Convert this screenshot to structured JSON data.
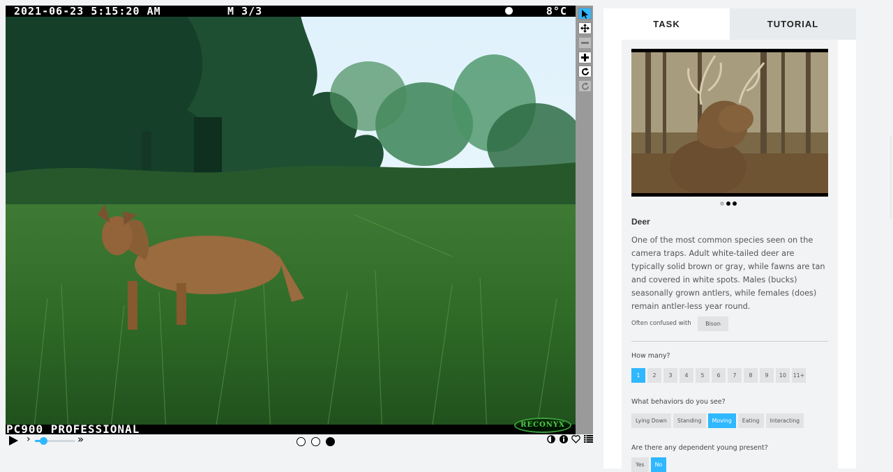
{
  "viewer": {
    "timestamp": "2021-06-23 5:15:20 AM",
    "mode": "M 3/3",
    "temperature": "8°C",
    "camera_model": "PC900 PROFESSIONAL",
    "brand_logo": "RECONYX",
    "tools": [
      {
        "name": "annotate-pointer-icon",
        "glyph": "➤",
        "state": "active"
      },
      {
        "name": "move-icon",
        "glyph": "✥",
        "state": "normal"
      },
      {
        "name": "zoom-out-icon",
        "glyph": "−",
        "state": "disabled"
      },
      {
        "name": "zoom-in-icon",
        "glyph": "+",
        "state": "normal"
      },
      {
        "name": "rotate-icon",
        "glyph": "↻",
        "state": "normal"
      },
      {
        "name": "reset-icon",
        "glyph": "⟳",
        "state": "disabled"
      }
    ],
    "frames": {
      "count": 3,
      "current": 3
    },
    "playback_speed": 0.2,
    "accent_color": "#2fb7ff"
  },
  "meta_icons": [
    "contrast-icon",
    "info-icon",
    "favorite-icon",
    "collections-icon"
  ],
  "tabs": {
    "task": "TASK",
    "tutorial": "TUTORIAL"
  },
  "species": {
    "name": "Deer",
    "description": "One of the most common species seen on the camera traps. Adult white-tailed deer are typically solid brown or gray, while fawns are tan and covered in white spots. Males (bucks) seasonally grown antlers, while females (does) remain antler-less year round.",
    "confused_label": "Often confused with",
    "confused_with": "Bison",
    "example_images": {
      "count": 3,
      "current": 2
    }
  },
  "questions": {
    "how_many": {
      "label": "How many?",
      "options": [
        "1",
        "2",
        "3",
        "4",
        "5",
        "6",
        "7",
        "8",
        "9",
        "10",
        "11+"
      ],
      "selected": "1"
    },
    "behaviors": {
      "label": "What behaviors do you see?",
      "options": [
        "Lying Down",
        "Standing",
        "Moving",
        "Eating",
        "Interacting"
      ],
      "selected": "Moving"
    },
    "young": {
      "label": "Are there any dependent young present?",
      "options": [
        "Yes",
        "No"
      ],
      "selected": "No"
    }
  }
}
